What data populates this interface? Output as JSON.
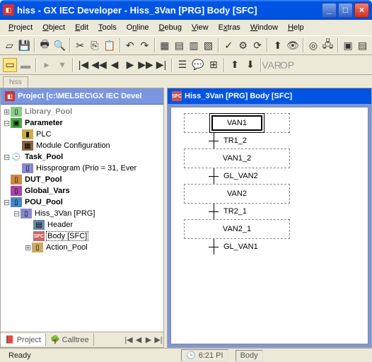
{
  "window": {
    "title": "hiss - GX IEC Developer - Hiss_3Van [PRG] Body [SFC]"
  },
  "menu": {
    "project": "Project",
    "object": "Object",
    "edit": "Edit",
    "tools": "Tools",
    "online": "Online",
    "debug": "Debug",
    "view": "View",
    "extras": "Extras",
    "window": "Window",
    "help": "Help"
  },
  "tabstrip": {
    "tab1": "hiss"
  },
  "tree": {
    "root": "Project [c:\\MELSEC\\GX IEC Devel",
    "library_pool": "Library_Pool",
    "parameter": "Parameter",
    "plc": "PLC",
    "module_config": "Module Configuration",
    "task_pool": "Task_Pool",
    "hissprogram": "Hissprogram (Prio = 31, Ever",
    "dut_pool": "DUT_Pool",
    "global_vars": "Global_Vars",
    "pou_pool": "POU_Pool",
    "hiss_3van": "Hiss_3Van [PRG]",
    "header": "Header",
    "body_sfc": "Body [SFC]",
    "action_pool": "Action_Pool"
  },
  "lefttabs": {
    "project": "Project",
    "calltree": "Calltree"
  },
  "doc": {
    "title": "Hiss_3Van [PRG] Body [SFC]"
  },
  "sfc": {
    "s1": "VAN1",
    "t1": "TR1_2",
    "s2": "VAN1_2",
    "t2": "GL_VAN2",
    "s3": "VAN2",
    "t3": "TR2_1",
    "s4": "VAN2_1",
    "t4": "GL_VAN1"
  },
  "status": {
    "ready": "Ready",
    "time": "6:21 PI",
    "mode": "Body"
  }
}
